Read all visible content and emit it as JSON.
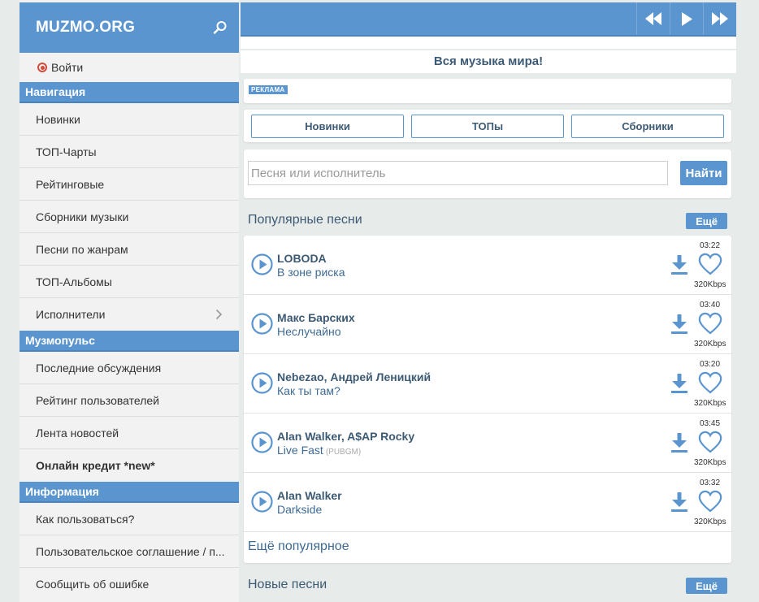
{
  "sidebar": {
    "logo": "MUZMO.ORG",
    "login": "Войти",
    "sections": [
      {
        "title": "Навигация",
        "items": [
          "Новинки",
          "ТОП-Чарты",
          "Рейтинговые",
          "Сборники музыки",
          "Песни по жанрам",
          "ТОП-Альбомы",
          "Исполнители"
        ]
      },
      {
        "title": "Музмопульс",
        "items": [
          "Последние обсуждения",
          "Рейтинг пользователей",
          "Лента новостей",
          "Онлайн кредит *new*"
        ]
      },
      {
        "title": "Информация",
        "items": [
          "Как пользоваться?",
          "Пользовательское соглашение / п...",
          "Сообщить об ошибке"
        ]
      }
    ]
  },
  "player": {
    "controls": [
      "prev-icon",
      "play-icon",
      "next-icon"
    ]
  },
  "tagline": "Вся музыка мира!",
  "ad_label": "РЕКЛАМА",
  "tabs": [
    "Новинки",
    "ТОПы",
    "Сборники"
  ],
  "search": {
    "placeholder": "Песня или исполнитель",
    "button": "Найти"
  },
  "popular": {
    "title": "Популярные песни",
    "more": "Ещё",
    "songs": [
      {
        "artist": "LOBODA",
        "title": "В зоне риска",
        "tag": "",
        "duration": "03:22",
        "bitrate": "320Kbps"
      },
      {
        "artist": "Макс Барских",
        "title": "Неслучайно",
        "tag": "",
        "duration": "03:40",
        "bitrate": "320Kbps"
      },
      {
        "artist": "Nebezao, Андрей Леницкий",
        "title": "Как ты там?",
        "tag": "",
        "duration": "03:20",
        "bitrate": "320Kbps"
      },
      {
        "artist": "Alan Walker, A$AP Rocky",
        "title": "Live Fast",
        "tag": "(PUBGM)",
        "duration": "03:45",
        "bitrate": "320Kbps"
      },
      {
        "artist": "Alan Walker",
        "title": "Darkside",
        "tag": "",
        "duration": "03:32",
        "bitrate": "320Kbps"
      }
    ],
    "more_link": "Ещё популярное"
  },
  "new_songs": {
    "title": "Новые песни",
    "more": "Ещё"
  },
  "colors": {
    "accent": "#5b95cf",
    "link": "#3d6a94",
    "heading": "#3d5a74"
  }
}
